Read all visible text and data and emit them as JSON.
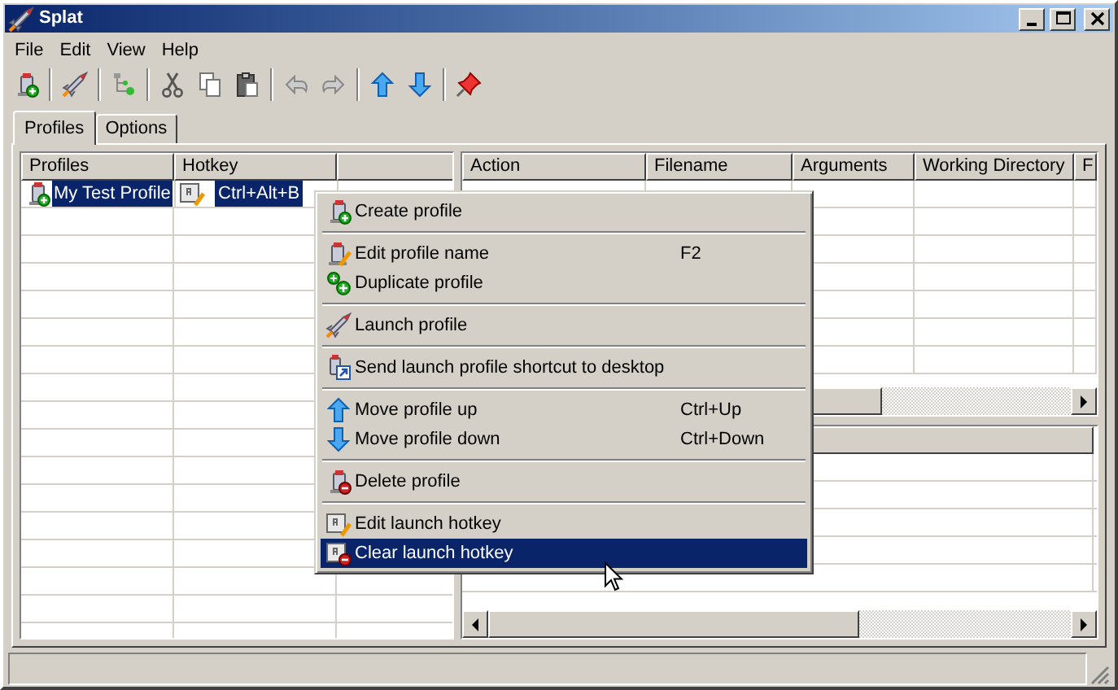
{
  "window": {
    "title": "Splat"
  },
  "menu": [
    {
      "label": "File"
    },
    {
      "label": "Edit"
    },
    {
      "label": "View"
    },
    {
      "label": "Help"
    }
  ],
  "toolbar": [
    {
      "kind": "add-profile"
    },
    {
      "kind": "separator"
    },
    {
      "kind": "rocket"
    },
    {
      "kind": "separator"
    },
    {
      "kind": "network"
    },
    {
      "kind": "separator"
    },
    {
      "kind": "cut"
    },
    {
      "kind": "copy"
    },
    {
      "kind": "paste"
    },
    {
      "kind": "separator"
    },
    {
      "kind": "undo"
    },
    {
      "kind": "redo"
    },
    {
      "kind": "separator"
    },
    {
      "kind": "up"
    },
    {
      "kind": "down"
    },
    {
      "kind": "separator"
    },
    {
      "kind": "pin"
    }
  ],
  "tabs": [
    {
      "label": "Profiles",
      "selected": true
    },
    {
      "label": "Options",
      "selected": false
    }
  ],
  "profiles_table": {
    "columns": [
      "Profiles",
      "Hotkey"
    ],
    "rows": [
      {
        "name": "My Test Profile",
        "hotkey": "Ctrl+Alt+B",
        "selected": true
      }
    ]
  },
  "actions_table": {
    "columns": [
      "Action",
      "Filename",
      "Arguments",
      "Working Directory",
      "F"
    ]
  },
  "context_menu": {
    "groups": [
      [
        {
          "label": "Create profile",
          "kind": "add-profile",
          "selected": false
        }
      ],
      [
        {
          "label": "Edit profile name",
          "kind": "edit-profile",
          "shortcut": "F2",
          "selected": false
        },
        {
          "label": "Duplicate profile",
          "kind": "duplicate",
          "selected": false
        }
      ],
      [
        {
          "label": "Launch profile",
          "kind": "rocket",
          "selected": false
        }
      ],
      [
        {
          "label": "Send launch profile shortcut to desktop",
          "kind": "shortcut",
          "selected": false
        }
      ],
      [
        {
          "label": "Move profile up",
          "kind": "up",
          "shortcut": "Ctrl+Up",
          "selected": false
        },
        {
          "label": "Move profile down",
          "kind": "down",
          "shortcut": "Ctrl+Down",
          "selected": false
        }
      ],
      [
        {
          "label": "Delete profile",
          "kind": "delete-profile",
          "selected": false
        }
      ],
      [
        {
          "label": "Edit launch hotkey",
          "kind": "edit-key",
          "selected": false
        },
        {
          "label": "Clear launch hotkey",
          "kind": "clear-key",
          "selected": true
        }
      ]
    ]
  }
}
